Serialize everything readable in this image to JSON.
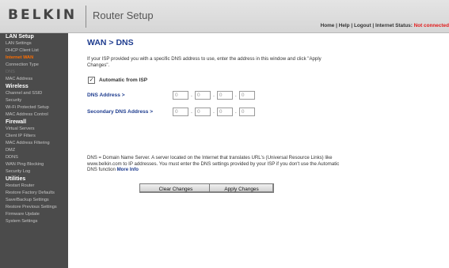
{
  "header": {
    "logo": "BELKIN",
    "app_title": "Router Setup",
    "links": {
      "home": "Home",
      "help": "Help",
      "logout": "Logout",
      "sep": "|",
      "status_label": "Internet Status:",
      "status_value": "Not connected"
    }
  },
  "sidebar": {
    "lan_setup": {
      "title": "LAN Setup",
      "items": [
        "LAN Settings",
        "DHCP Client List"
      ]
    },
    "internet_wan": {
      "title": "Internet WAN",
      "items": [
        "Connection Type",
        "DNS",
        "MAC Address"
      ]
    },
    "wireless": {
      "title": "Wireless",
      "items": [
        "Channel and SSID",
        "Security",
        "Wi-Fi Protected Setup",
        "MAC Address Control"
      ]
    },
    "firewall": {
      "title": "Firewall",
      "items": [
        "Virtual Servers",
        "Client IP Filters",
        "MAC Address Filtering",
        "DMZ",
        "DDNS",
        "WAN Ping Blocking",
        "Security Log"
      ]
    },
    "utilities": {
      "title": "Utilities",
      "items": [
        "Restart Router",
        "Restore Factory Defaults",
        "Save/Backup Settings",
        "Restore Previous Settings",
        "Firmware Update",
        "System Settings"
      ]
    }
  },
  "main": {
    "title": "WAN > DNS",
    "intro": "If your ISP provided you with a specific DNS address to use, enter the address in this window and click \"Apply Changes\".",
    "auto_label": "Automatic from ISP",
    "auto_checked": true,
    "dns_label": "DNS Address >",
    "secondary_label": "Secondary DNS Address >",
    "dns_octets": [
      "0",
      "0",
      "0",
      "0"
    ],
    "secondary_octets": [
      "0",
      "0",
      "0",
      "0"
    ],
    "octet_sep": ".",
    "info_text": "DNS = Domain Name Server. A server located on the Internet that translates URL's (Universal Resource Links) like www.belkin.com to IP addresses. You must enter the DNS settings provided by your ISP if you don't use the Automatic DNS function",
    "more_info": "More Info",
    "clear_button": "Clear Changes",
    "apply_button": "Apply Changes"
  },
  "colors": {
    "header_bg": "#dcdcdc",
    "sidebar_bg": "#4b4b4b",
    "active_nav": "#ff6e00",
    "title_blue": "#1f3d8f",
    "status_red": "#e21a1a"
  },
  "icons": {
    "checkbox": "check-icon"
  }
}
